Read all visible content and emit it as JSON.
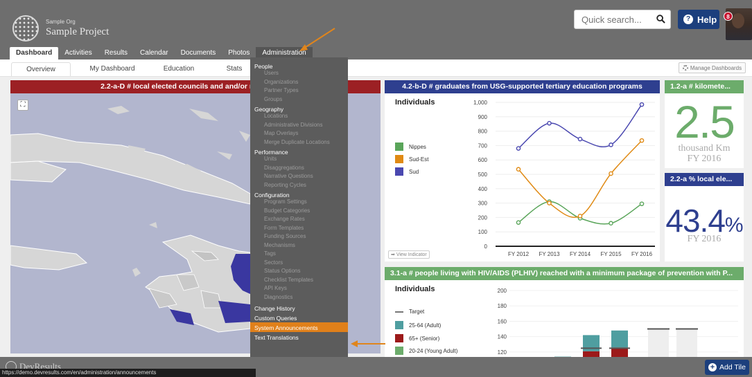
{
  "header": {
    "org_name": "Sample Org",
    "project_name": "Sample Project",
    "search_placeholder": "Quick search...",
    "help_label": "Help",
    "notification_count": "8"
  },
  "main_nav": [
    {
      "label": "Dashboard",
      "active": true
    },
    {
      "label": "Activities"
    },
    {
      "label": "Results"
    },
    {
      "label": "Calendar"
    },
    {
      "label": "Documents"
    },
    {
      "label": "Photos"
    },
    {
      "label": "Administration",
      "open": true
    }
  ],
  "sub_tabs": [
    "Overview",
    "My Dashboard",
    "Education",
    "Stats"
  ],
  "manage_dashboards_label": "Manage Dashboards",
  "map_tile": {
    "title": "2.2-a-D # local elected councils and and/or mayorships"
  },
  "line_tile": {
    "title": "4.2-b-D # graduates from USG-supported tertiary education programs",
    "subtitle": "Individuals",
    "view_indicator": "View Indicator",
    "colors": {
      "Nippes": "#5aa55a",
      "Sud-Est": "#e08a14",
      "Sud": "#4a48b0"
    }
  },
  "kpi1": {
    "title": "1.2-a # kilomete...",
    "value": "2.5",
    "unit": "thousand Km",
    "period": "FY 2016"
  },
  "kpi2": {
    "title": "2.2-a % local ele...",
    "value": "43.4",
    "suffix": "%",
    "period": "FY 2016"
  },
  "bar_tile": {
    "title": "3.1-a # people living with HIV/AIDS (PLHIV) reached with a minimum package of prevention with P...",
    "subtitle": "Individuals",
    "legend": [
      {
        "label": "Target",
        "color": "#777777",
        "kind": "line"
      },
      {
        "label": "25-64 (Adult)",
        "color": "#4f9ea0"
      },
      {
        "label": "65+ (Senior)",
        "color": "#9c1a1a"
      },
      {
        "label": "20-24 (Young Adult)",
        "color": "#6cac6b"
      }
    ]
  },
  "admin_menu": [
    {
      "group": "People",
      "items": [
        "Users",
        "Organizations",
        "Partner Types",
        "Groups"
      ]
    },
    {
      "group": "Geography",
      "items": [
        "Locations",
        "Administrative Divisions",
        "Map Overlays",
        "Merge Duplicate Locations"
      ]
    },
    {
      "group": "Performance",
      "items": [
        "Units",
        "Disaggregations",
        "Narrative Questions",
        "Reporting Cycles"
      ]
    },
    {
      "group": "Configuration",
      "items": [
        "Program Settings",
        "Budget Categories",
        "Exchange Rates",
        "Form Templates",
        "Funding Sources",
        "Mechanisms",
        "Tags",
        "Sectors",
        "Status Options",
        "Checklist Templates",
        "API Keys",
        "Diagnostics"
      ]
    }
  ],
  "admin_top_items": [
    "Change History",
    "Custom Queries",
    "System Announcements",
    "Text Translations"
  ],
  "highlighted_item": "System Announcements",
  "footer": {
    "logo_text": "DevResults",
    "status_url": "https://demo.devresults.com/en/administration/announcements",
    "add_tile_label": "Add Tile"
  },
  "chart_data": [
    {
      "type": "line",
      "title": "4.2-b-D # graduates from USG-supported tertiary education programs",
      "x": [
        "FY 2012",
        "FY 2013",
        "FY 2014",
        "FY 2015",
        "FY 2016"
      ],
      "ylim": [
        0,
        1000
      ],
      "yticks": [
        0,
        100,
        200,
        300,
        400,
        500,
        600,
        700,
        800,
        900,
        1000
      ],
      "series": [
        {
          "name": "Nippes",
          "values": [
            165,
            310,
            195,
            160,
            295
          ]
        },
        {
          "name": "Sud-Est",
          "values": [
            535,
            300,
            210,
            505,
            735
          ]
        },
        {
          "name": "Sud",
          "values": [
            680,
            855,
            745,
            705,
            985
          ]
        }
      ],
      "legend": "left"
    },
    {
      "type": "bar",
      "title": "3.1-a # people living with HIV/AIDS (PLHIV) reached with a minimum package of prevention with P...",
      "yticks_visible": [
        120,
        140,
        160,
        180,
        200
      ],
      "ylim_visible": [
        110,
        200
      ],
      "stacks": [
        {
          "index": 2,
          "segments": {
            "20-24 (Young Adult)": 3,
            "65+ (Senior)": 0,
            "25-64 (Adult)": 111
          }
        },
        {
          "index": 3,
          "segments": {
            "65+ (Senior)": 121,
            "25-64 (Adult)": 21
          },
          "target": 125
        },
        {
          "index": 4,
          "segments": {
            "65+ (Senior)": 126,
            "25-64 (Adult)": 22
          },
          "target": 125
        }
      ],
      "targets_only": [
        {
          "index": 5,
          "target": 150
        },
        {
          "index": 6,
          "target": 150
        }
      ]
    }
  ]
}
